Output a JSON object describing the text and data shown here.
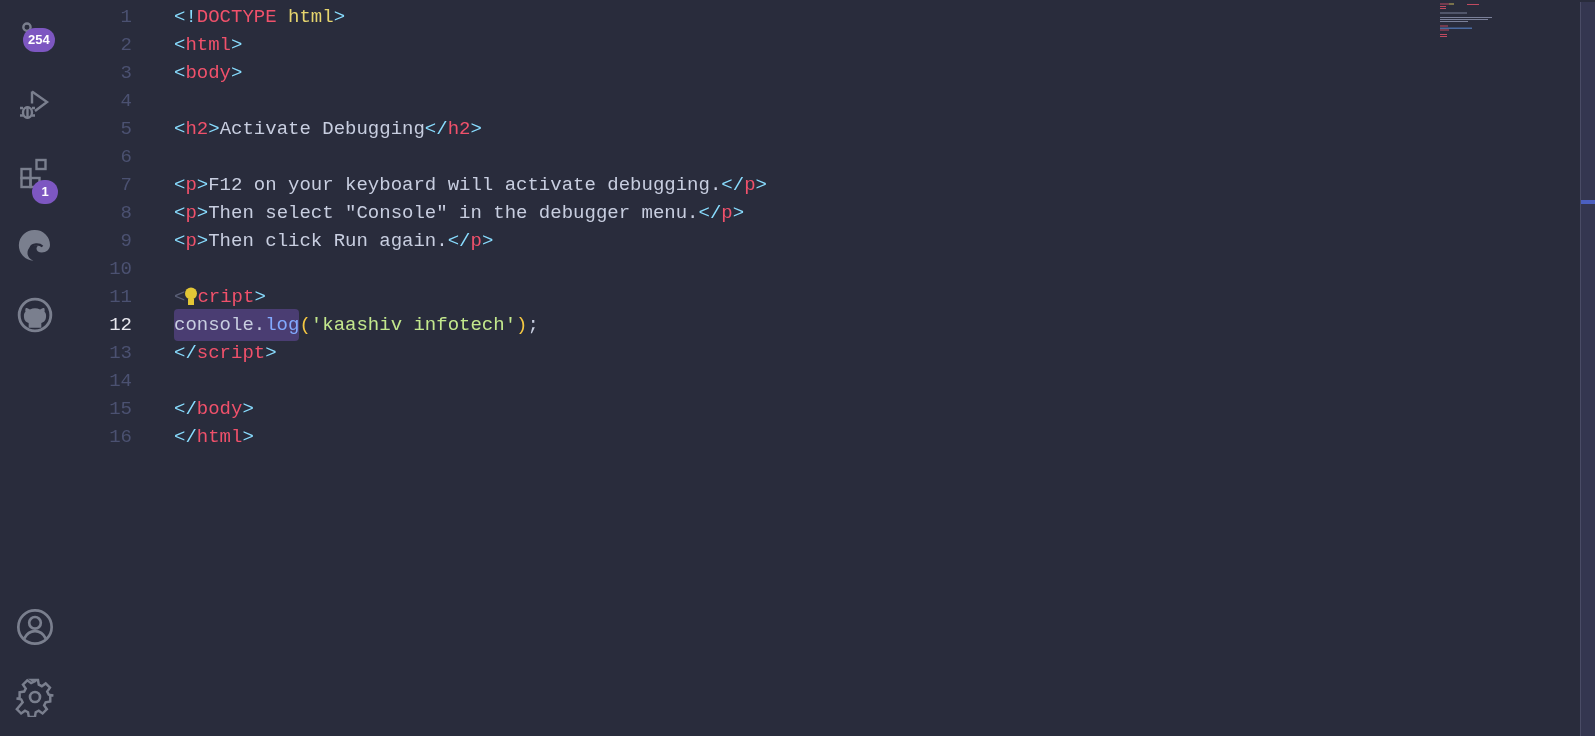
{
  "activity_bar": [
    {
      "kind": "source-control",
      "badge": "254"
    },
    {
      "kind": "run-debug"
    },
    {
      "kind": "extensions",
      "badge": "1"
    },
    {
      "kind": "browser"
    },
    {
      "kind": "github"
    }
  ],
  "activity_bar_bottom": [
    {
      "kind": "account"
    },
    {
      "kind": "settings"
    }
  ],
  "editor": {
    "lines": [
      {
        "number": "1",
        "current": false,
        "tokens": [
          {
            "text": "<!",
            "kind": "punct"
          },
          {
            "text": "DOCTYPE",
            "kind": "tag"
          },
          {
            "text": " html",
            "kind": "attr"
          },
          {
            "text": ">",
            "kind": "punct"
          }
        ]
      },
      {
        "number": "2",
        "current": false,
        "tokens": [
          {
            "text": "<",
            "kind": "punct"
          },
          {
            "text": "html",
            "kind": "tag"
          },
          {
            "text": ">",
            "kind": "punct"
          }
        ]
      },
      {
        "number": "3",
        "current": false,
        "tokens": [
          {
            "text": "<",
            "kind": "punct"
          },
          {
            "text": "body",
            "kind": "tag"
          },
          {
            "text": ">",
            "kind": "punct"
          }
        ]
      },
      {
        "number": "4",
        "current": false
      },
      {
        "number": "5",
        "current": false,
        "tokens": [
          {
            "text": "<",
            "kind": "punct"
          },
          {
            "text": "h2",
            "kind": "tag"
          },
          {
            "text": ">",
            "kind": "punct"
          },
          {
            "text": "Activate Debugging",
            "kind": "text"
          },
          {
            "text": "</",
            "kind": "punct"
          },
          {
            "text": "h2",
            "kind": "tag"
          },
          {
            "text": ">",
            "kind": "punct"
          }
        ]
      },
      {
        "number": "6",
        "current": false
      },
      {
        "number": "7",
        "current": false,
        "tokens": [
          {
            "text": "<",
            "kind": "punct"
          },
          {
            "text": "p",
            "kind": "tag"
          },
          {
            "text": ">",
            "kind": "punct"
          },
          {
            "text": "F12 on your keyboard will activate debugging.",
            "kind": "text"
          },
          {
            "text": "</",
            "kind": "punct"
          },
          {
            "text": "p",
            "kind": "tag"
          },
          {
            "text": ">",
            "kind": "punct"
          }
        ]
      },
      {
        "number": "8",
        "current": false,
        "tokens": [
          {
            "text": "<",
            "kind": "punct"
          },
          {
            "text": "p",
            "kind": "tag"
          },
          {
            "text": ">",
            "kind": "punct"
          },
          {
            "text": "Then select \"Console\" in the debugger menu.",
            "kind": "text"
          },
          {
            "text": "</",
            "kind": "punct"
          },
          {
            "text": "p",
            "kind": "tag"
          },
          {
            "text": ">",
            "kind": "punct"
          }
        ]
      },
      {
        "number": "9",
        "current": false,
        "tokens": [
          {
            "text": "<",
            "kind": "punct"
          },
          {
            "text": "p",
            "kind": "tag"
          },
          {
            "text": ">",
            "kind": "punct"
          },
          {
            "text": "Then click Run again.",
            "kind": "text"
          },
          {
            "text": "</",
            "kind": "punct"
          },
          {
            "text": "p",
            "kind": "tag"
          },
          {
            "text": ">",
            "kind": "punct"
          }
        ]
      },
      {
        "number": "10",
        "current": false
      },
      {
        "number": "11",
        "current": false,
        "lightbulb": true,
        "tokens": [
          {
            "text": "<",
            "kind": "dim"
          },
          {
            "text": "cript",
            "kind": "tag"
          },
          {
            "text": ">",
            "kind": "punct"
          }
        ]
      },
      {
        "number": "12",
        "current": true,
        "tokens": [
          {
            "text": "console.",
            "kind": "text",
            "highlighted": true
          },
          {
            "text": "log",
            "kind": "func",
            "highlighted": true
          },
          {
            "text": "(",
            "kind": "paren"
          },
          {
            "text": "'kaashiv infotech'",
            "kind": "string"
          },
          {
            "text": ")",
            "kind": "paren"
          },
          {
            "text": ";",
            "kind": "text"
          }
        ]
      },
      {
        "number": "13",
        "current": false,
        "tokens": [
          {
            "text": "</",
            "kind": "punct"
          },
          {
            "text": "script",
            "kind": "tag"
          },
          {
            "text": ">",
            "kind": "punct"
          }
        ]
      },
      {
        "number": "14",
        "current": false
      },
      {
        "number": "15",
        "current": false,
        "tokens": [
          {
            "text": "</",
            "kind": "punct"
          },
          {
            "text": "body",
            "kind": "tag"
          },
          {
            "text": ">",
            "kind": "punct"
          }
        ]
      },
      {
        "number": "16",
        "current": false,
        "tokens": [
          {
            "text": "</",
            "kind": "punct"
          },
          {
            "text": "html",
            "kind": "tag"
          },
          {
            "text": ">",
            "kind": "punct"
          }
        ]
      }
    ]
  }
}
